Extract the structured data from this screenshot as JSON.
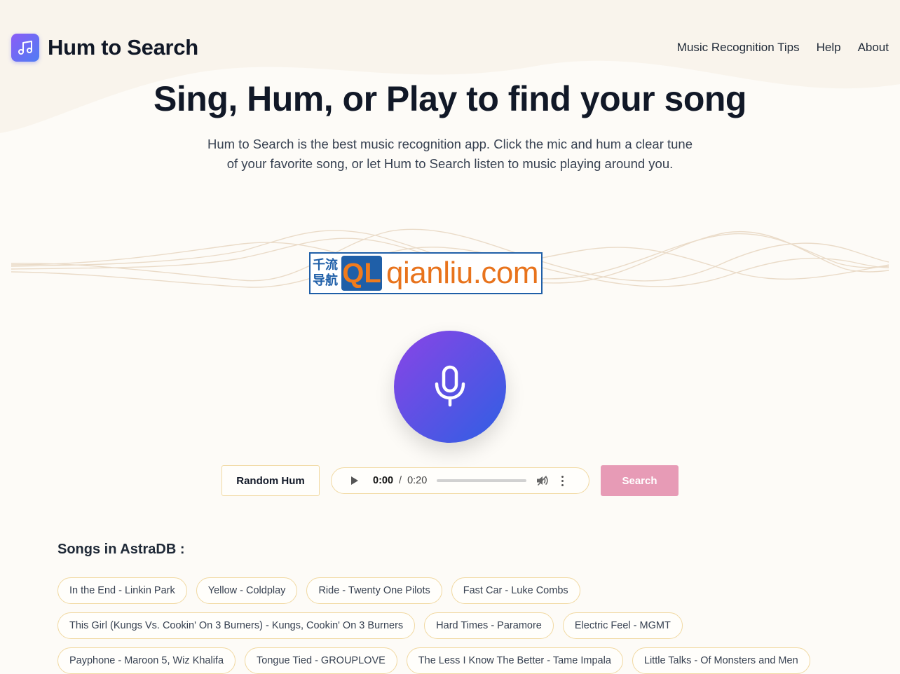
{
  "header": {
    "logo_icon": "music-note-icon",
    "app_title": "Hum to Search",
    "nav": [
      "Music Recognition Tips",
      "Help",
      "About"
    ]
  },
  "hero": {
    "title": "Sing, Hum, or Play to find your song",
    "subtitle_line1": "Hum to Search is the best music recognition app. Click the mic and hum a clear tune",
    "subtitle_line2": "of your favorite song, or let Hum to Search listen to music playing around you."
  },
  "watermark": {
    "cn_line1": "千流",
    "cn_line2": "导航",
    "badge": "QL",
    "url": "qianliu.com"
  },
  "mic_button": {
    "icon": "microphone-icon"
  },
  "controls": {
    "random_label": "Random Hum",
    "audio": {
      "current_time": "0:00",
      "separator": "/",
      "total_time": "0:20",
      "progress": 0
    },
    "search_label": "Search"
  },
  "songs": {
    "heading": "Songs in AstraDB :",
    "rows": [
      [
        "In the End - Linkin Park",
        "Yellow - Coldplay",
        "Ride - Twenty One Pilots",
        "Fast Car - Luke Combs"
      ],
      [
        "This Girl (Kungs Vs. Cookin' On 3 Burners) - Kungs, Cookin' On 3 Burners",
        "Hard Times - Paramore",
        "Electric Feel - MGMT"
      ],
      [
        "Payphone - Maroon 5, Wiz Khalifa",
        "Tongue Tied - GROUPLOVE",
        "The Less I Know The Better - Tame Impala",
        "Little Talks - Of Monsters and Men"
      ]
    ]
  },
  "colors": {
    "background": "#fdfbf7",
    "accent_gradient_start": "#8a44e6",
    "accent_gradient_end": "#2f5fe3",
    "search_button": "#e79bb6",
    "tag_border": "#f1d9a2"
  }
}
